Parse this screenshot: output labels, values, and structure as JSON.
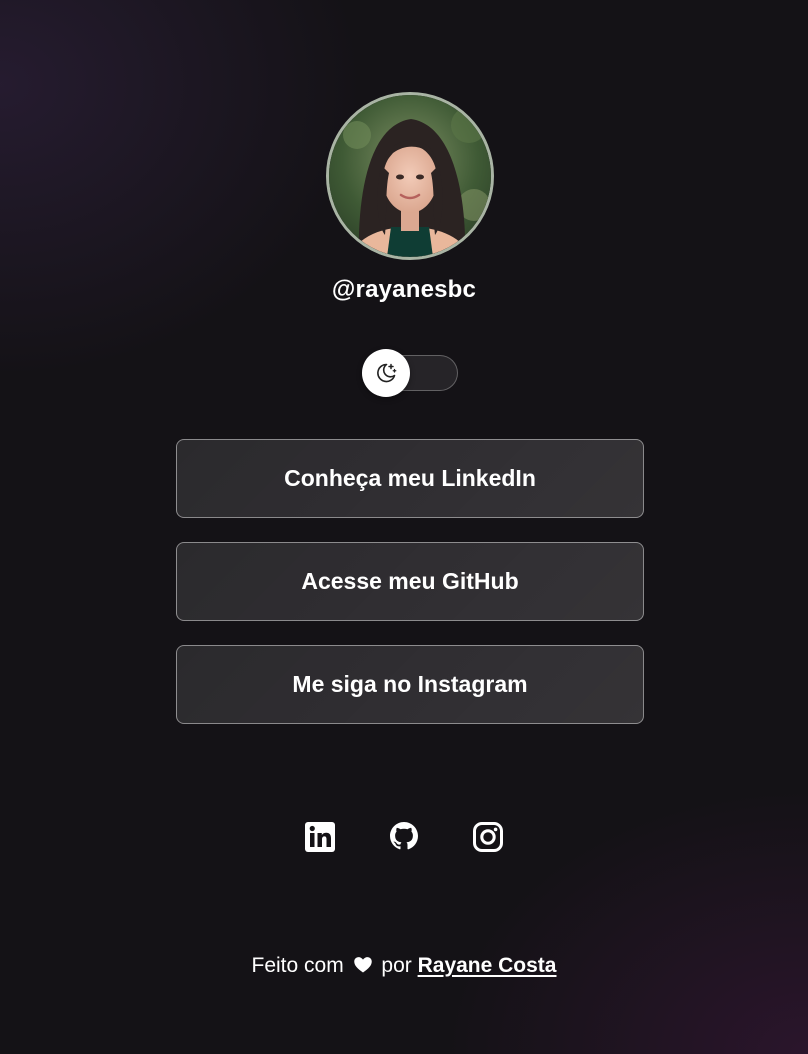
{
  "profile": {
    "handle": "@rayanesbc",
    "avatar_alt": "Rayane Costa"
  },
  "theme_toggle": {
    "icon": "moon-stars-icon",
    "state": "dark"
  },
  "links": [
    {
      "label": "Conheça meu LinkedIn",
      "icon": "linkedin-icon"
    },
    {
      "label": "Acesse meu GitHub",
      "icon": "github-icon"
    },
    {
      "label": "Me siga no Instagram",
      "icon": "instagram-icon"
    }
  ],
  "social_icons": [
    "linkedin-icon",
    "github-icon",
    "instagram-icon"
  ],
  "footer": {
    "prefix": "Feito com",
    "middle": "por",
    "author": "Rayane Costa",
    "heart_icon": "heart-icon"
  },
  "colors": {
    "background": "#141216",
    "text": "#ffffff",
    "avatar_border": "#a9b4a4"
  }
}
